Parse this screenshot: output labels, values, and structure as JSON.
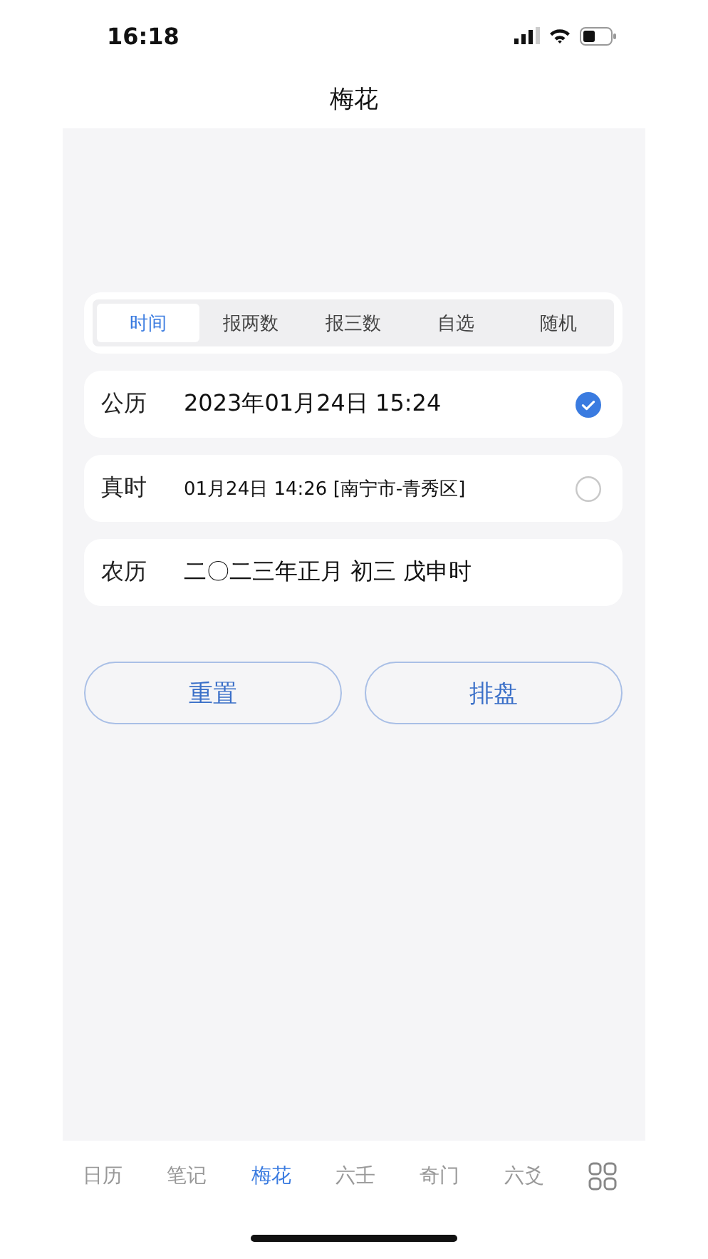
{
  "status_bar": {
    "time": "16:18"
  },
  "title": "梅花",
  "segments": [
    {
      "label": "时间",
      "selected": true
    },
    {
      "label": "报两数",
      "selected": false
    },
    {
      "label": "报三数",
      "selected": false
    },
    {
      "label": "自选",
      "selected": false
    },
    {
      "label": "随机",
      "selected": false
    }
  ],
  "rows": [
    {
      "kind": "option",
      "label": "公历",
      "value": "2023年01月24日 15:24",
      "selected": true
    },
    {
      "kind": "option",
      "label": "真时",
      "value": "01月24日 14:26 [南宁市-青秀区]",
      "selected": false
    },
    {
      "kind": "plain",
      "label": "农历",
      "value": "二〇二三年正月 初三 戊申时"
    }
  ],
  "buttons": [
    "重置",
    "排盘"
  ],
  "tab_bar": [
    {
      "label": "日历",
      "selected": false
    },
    {
      "label": "笔记",
      "selected": false
    },
    {
      "label": "梅花",
      "selected": true
    },
    {
      "label": "六壬",
      "selected": false
    },
    {
      "label": "奇门",
      "selected": false
    },
    {
      "label": "六爻",
      "selected": false
    },
    {
      "kind": "grid",
      "selected": false
    }
  ]
}
